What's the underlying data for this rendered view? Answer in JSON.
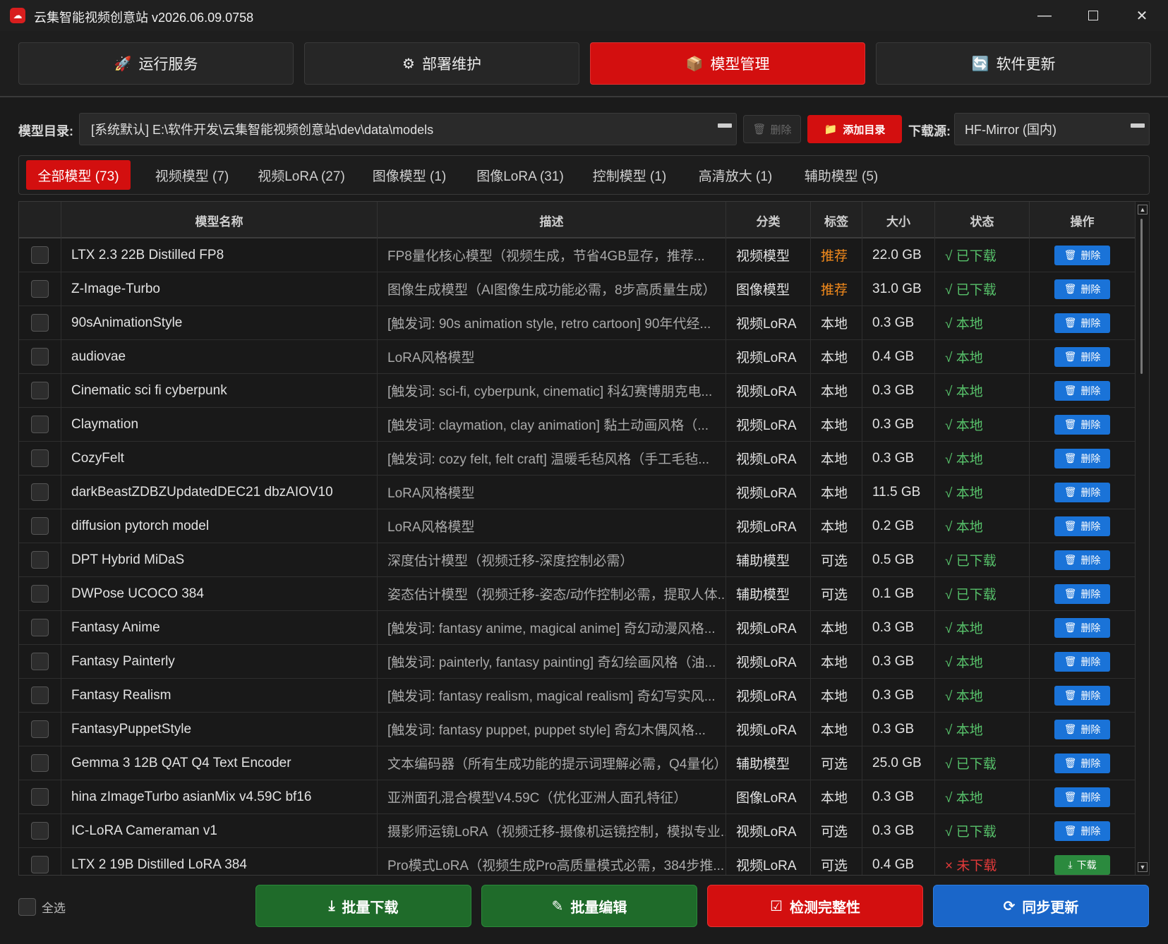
{
  "window": {
    "title": "云集智能视频创意站 v2026.06.09.0758",
    "minimize": "—",
    "close": "✕"
  },
  "main_tabs": [
    {
      "icon": "🚀",
      "label": "运行服务"
    },
    {
      "icon": "⚙",
      "label": "部署维护"
    },
    {
      "icon": "📦",
      "label": "模型管理"
    },
    {
      "icon": "🔄",
      "label": "软件更新"
    }
  ],
  "directory": {
    "label": "模型目录:",
    "value": "[系统默认] E:\\软件开发\\云集智能视频创意站\\dev\\data\\models",
    "delete_label": "删除",
    "add_label": "添加目录"
  },
  "source": {
    "label": "下载源:",
    "value": "HF-Mirror (国内)"
  },
  "category_tabs": [
    "全部模型 (73)",
    "视频模型 (7)",
    "视频LoRA (27)",
    "图像模型 (1)",
    "图像LoRA (31)",
    "控制模型 (1)",
    "高清放大 (1)",
    "辅助模型 (5)"
  ],
  "table": {
    "headers": [
      "模型名称",
      "描述",
      "分类",
      "标签",
      "大小",
      "状态",
      "操作"
    ],
    "rows": [
      {
        "name": "LTX 2.3 22B Distilled FP8",
        "desc": "FP8量化核心模型（视频生成，节省4GB显存，推荐...",
        "cat": "视频模型",
        "tag": "推荐",
        "size": "22.0 GB",
        "status": "√ 已下载",
        "op": "删除"
      },
      {
        "name": "Z-Image-Turbo",
        "desc": "图像生成模型（AI图像生成功能必需，8步高质量生成）",
        "cat": "图像模型",
        "tag": "推荐",
        "size": "31.0 GB",
        "status": "√ 已下载",
        "op": "删除"
      },
      {
        "name": "90sAnimationStyle",
        "desc": "[触发词: 90s animation style, retro cartoon] 90年代经...",
        "cat": "视频LoRA",
        "tag": "本地",
        "size": "0.3 GB",
        "status": "√ 本地",
        "op": "删除"
      },
      {
        "name": "audiovae",
        "desc": "LoRA风格模型",
        "cat": "视频LoRA",
        "tag": "本地",
        "size": "0.4 GB",
        "status": "√ 本地",
        "op": "删除"
      },
      {
        "name": "Cinematic sci fi cyberpunk",
        "desc": "[触发词: sci-fi, cyberpunk, cinematic] 科幻赛博朋克电...",
        "cat": "视频LoRA",
        "tag": "本地",
        "size": "0.3 GB",
        "status": "√ 本地",
        "op": "删除"
      },
      {
        "name": "Claymation",
        "desc": "[触发词: claymation, clay animation] 黏土动画风格（...",
        "cat": "视频LoRA",
        "tag": "本地",
        "size": "0.3 GB",
        "status": "√ 本地",
        "op": "删除"
      },
      {
        "name": "CozyFelt",
        "desc": "[触发词: cozy felt, felt craft] 温暖毛毡风格（手工毛毡...",
        "cat": "视频LoRA",
        "tag": "本地",
        "size": "0.3 GB",
        "status": "√ 本地",
        "op": "删除"
      },
      {
        "name": "darkBeastZDBZUpdatedDEC21 dbzAIOV10",
        "desc": "LoRA风格模型",
        "cat": "视频LoRA",
        "tag": "本地",
        "size": "11.5 GB",
        "status": "√ 本地",
        "op": "删除"
      },
      {
        "name": "diffusion pytorch model",
        "desc": "LoRA风格模型",
        "cat": "视频LoRA",
        "tag": "本地",
        "size": "0.2 GB",
        "status": "√ 本地",
        "op": "删除"
      },
      {
        "name": "DPT Hybrid MiDaS",
        "desc": "深度估计模型（视频迁移-深度控制必需）",
        "cat": "辅助模型",
        "tag": "可选",
        "size": "0.5 GB",
        "status": "√ 已下载",
        "op": "删除"
      },
      {
        "name": "DWPose UCOCO 384",
        "desc": "姿态估计模型（视频迁移-姿态/动作控制必需，提取人体...",
        "cat": "辅助模型",
        "tag": "可选",
        "size": "0.1 GB",
        "status": "√ 已下载",
        "op": "删除"
      },
      {
        "name": "Fantasy Anime",
        "desc": "[触发词: fantasy anime, magical anime] 奇幻动漫风格...",
        "cat": "视频LoRA",
        "tag": "本地",
        "size": "0.3 GB",
        "status": "√ 本地",
        "op": "删除"
      },
      {
        "name": "Fantasy Painterly",
        "desc": "[触发词: painterly, fantasy painting] 奇幻绘画风格（油...",
        "cat": "视频LoRA",
        "tag": "本地",
        "size": "0.3 GB",
        "status": "√ 本地",
        "op": "删除"
      },
      {
        "name": "Fantasy Realism",
        "desc": "[触发词: fantasy realism, magical realism] 奇幻写实风...",
        "cat": "视频LoRA",
        "tag": "本地",
        "size": "0.3 GB",
        "status": "√ 本地",
        "op": "删除"
      },
      {
        "name": "FantasyPuppetStyle",
        "desc": "[触发词: fantasy puppet, puppet style] 奇幻木偶风格...",
        "cat": "视频LoRA",
        "tag": "本地",
        "size": "0.3 GB",
        "status": "√ 本地",
        "op": "删除"
      },
      {
        "name": "Gemma 3 12B QAT Q4 Text Encoder",
        "desc": "文本编码器（所有生成功能的提示词理解必需，Q4量化）",
        "cat": "辅助模型",
        "tag": "可选",
        "size": "25.0 GB",
        "status": "√ 已下载",
        "op": "删除"
      },
      {
        "name": "hina zImageTurbo asianMix v4.59C bf16",
        "desc": "亚洲面孔混合模型V4.59C（优化亚洲人面孔特征）",
        "cat": "图像LoRA",
        "tag": "本地",
        "size": "0.3 GB",
        "status": "√ 本地",
        "op": "删除"
      },
      {
        "name": "IC-LoRA Cameraman v1",
        "desc": "摄影师运镜LoRA（视频迁移-摄像机运镜控制，模拟专业...",
        "cat": "视频LoRA",
        "tag": "可选",
        "size": "0.3 GB",
        "status": "√ 已下载",
        "op": "删除"
      },
      {
        "name": "LTX 2 19B Distilled LoRA 384",
        "desc": "Pro模式LoRA（视频生成Pro高质量模式必需，384步推...",
        "cat": "视频LoRA",
        "tag": "可选",
        "size": "0.4 GB",
        "status": "× 未下载",
        "op": "下载"
      }
    ]
  },
  "bottom": {
    "select_all": "全选",
    "batch_download": "批量下载",
    "batch_edit": "批量编辑",
    "check_integrity": "检测完整性",
    "sync_update": "同步更新"
  },
  "colors": {
    "accent_red": "#d30f0f",
    "ok_green": "#57c16a",
    "warn_orange": "#f28a1c",
    "action_blue": "#1a73d8"
  }
}
